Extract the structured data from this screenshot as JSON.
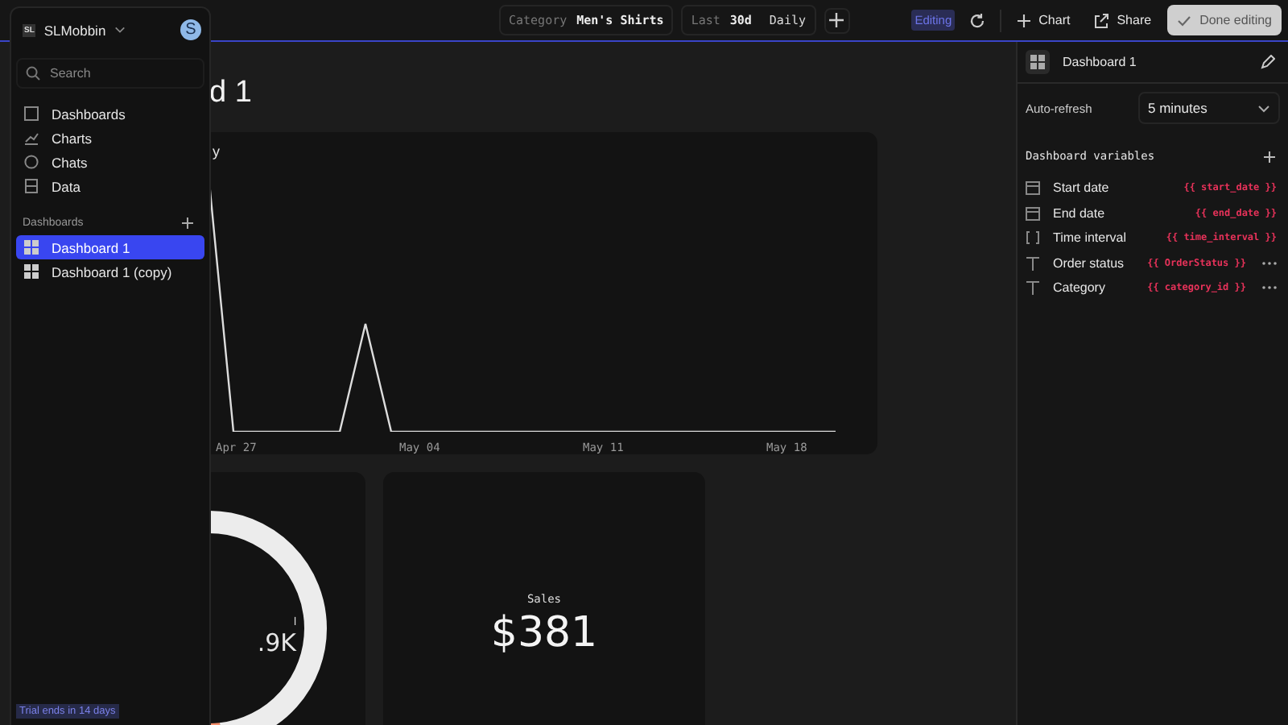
{
  "workspace": {
    "badge": "SL",
    "name": "SLMobbin",
    "avatar": "S"
  },
  "search": {
    "placeholder": "Search"
  },
  "nav": [
    {
      "kind": "dashboards",
      "label": "Dashboards"
    },
    {
      "kind": "charts",
      "label": "Charts"
    },
    {
      "kind": "chats",
      "label": "Chats"
    },
    {
      "kind": "data",
      "label": "Data"
    }
  ],
  "dashboards_section": {
    "title": "Dashboards",
    "items": [
      {
        "label": "Dashboard 1",
        "selected": true
      },
      {
        "label": "Dashboard 1 (copy)",
        "selected": false
      }
    ]
  },
  "trial": "Trial ends in 14 days",
  "filters": [
    {
      "label": "Category",
      "value": "Men's Shirts"
    },
    {
      "label": "Last",
      "value": "30d",
      "extra": "Daily"
    }
  ],
  "toolbar": {
    "status": "Editing",
    "chart": "Chart",
    "share": "Share",
    "done": "Done editing"
  },
  "page_title": "d 1",
  "line_card": {
    "title": "y",
    "x_labels": [
      "Apr 27",
      "May 04",
      "May 11",
      "May 18"
    ]
  },
  "donut_card": {
    "label": "l",
    "value": ".9K"
  },
  "sales_card": {
    "label": "Sales",
    "value": "$381"
  },
  "panel": {
    "title": "Dashboard 1",
    "auto_refresh_label": "Auto-refresh",
    "auto_refresh_value": "5 minutes",
    "variables_title": "Dashboard variables",
    "variables": [
      {
        "kind": "date",
        "name": "Start date",
        "token": "{{ start_date }}",
        "menu": false
      },
      {
        "kind": "date",
        "name": "End date",
        "token": "{{ end_date }}",
        "menu": false
      },
      {
        "kind": "interval",
        "name": "Time interval",
        "token": "{{ time_interval }}",
        "menu": false
      },
      {
        "kind": "text",
        "name": "Order status",
        "token": "{{ OrderStatus }}",
        "menu": true
      },
      {
        "kind": "text",
        "name": "Category",
        "token": "{{ category_id }}",
        "menu": true
      }
    ]
  }
}
